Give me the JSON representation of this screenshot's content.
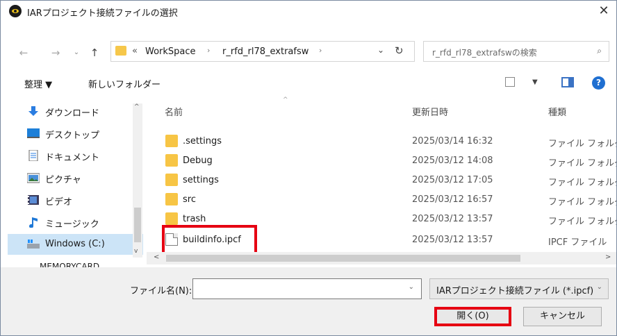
{
  "window": {
    "title": "IARプロジェクト接続ファイルの選択",
    "close_glyph": "✕"
  },
  "nav": {
    "back": "←",
    "forward": "→",
    "up": "↑",
    "chevron": "«",
    "breadcrumbs": [
      "WorkSpace",
      "r_rfd_rl78_extrafsw"
    ],
    "sep": "›",
    "dropdown": "⌄",
    "refresh": "↻"
  },
  "search": {
    "placeholder": "r_rfd_rl78_extrafswの検索",
    "icon_glyph": "⌕"
  },
  "toolbar": {
    "organize": "整理 ▼",
    "new_folder": "新しいフォルダー",
    "view_drop": "▼",
    "help": "?"
  },
  "sidebar": {
    "items": [
      {
        "label": "ダウンロード",
        "icon": "download-icon"
      },
      {
        "label": "デスクトップ",
        "icon": "desktop-icon"
      },
      {
        "label": "ドキュメント",
        "icon": "document-icon"
      },
      {
        "label": "ピクチャ",
        "icon": "picture-icon"
      },
      {
        "label": "ビデオ",
        "icon": "video-icon"
      },
      {
        "label": "ミュージック",
        "icon": "music-icon"
      },
      {
        "label": "Windows (C:)",
        "icon": "drive-icon"
      }
    ],
    "cut_item": "MEMORYCARD"
  },
  "columns": {
    "name": "名前",
    "date": "更新日時",
    "type": "種類"
  },
  "files": [
    {
      "name": ".settings",
      "date": "2025/03/14 16:32",
      "type": "ファイル フォルダー",
      "kind": "folder"
    },
    {
      "name": "Debug",
      "date": "2025/03/12 14:08",
      "type": "ファイル フォルダー",
      "kind": "folder"
    },
    {
      "name": "settings",
      "date": "2025/03/12 17:05",
      "type": "ファイル フォルダー",
      "kind": "folder"
    },
    {
      "name": "src",
      "date": "2025/03/12 16:57",
      "type": "ファイル フォルダー",
      "kind": "folder"
    },
    {
      "name": "trash",
      "date": "2025/03/12 13:57",
      "type": "ファイル フォルダー",
      "kind": "folder"
    },
    {
      "name": "buildinfo.ipcf",
      "date": "2025/03/12 13:57",
      "type": "IPCF ファイル",
      "kind": "file"
    }
  ],
  "bottom": {
    "filename_label": "ファイル名(N):",
    "filename_value": "",
    "filetype": "IARプロジェクト接続ファイル (*.ipcf)",
    "open": "開く(O)",
    "cancel": "キャンセル"
  },
  "colors": {
    "highlight": "#e60012",
    "selection": "#cce4f7",
    "folder": "#f7c545",
    "accent": "#1f6fd1"
  }
}
